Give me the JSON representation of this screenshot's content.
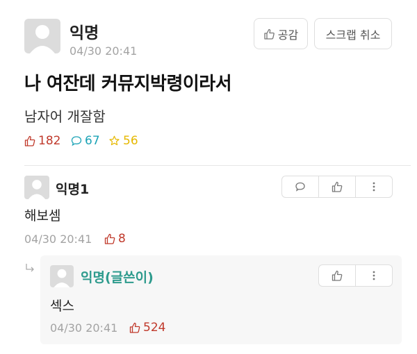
{
  "post": {
    "author": "익명",
    "time": "04/30 20:41",
    "title": "나 여잔데 커뮤지박령이라서",
    "body": "남자어 개잘함",
    "likes": "182",
    "comments": "67",
    "scraps": "56",
    "buttons": {
      "like": "공감",
      "scrap_cancel": "스크랩 취소"
    }
  },
  "comment": {
    "author": "익명1",
    "text": "해보셈",
    "time": "04/30 20:41",
    "likes": "8"
  },
  "reply": {
    "author": "익명(글쓴이)",
    "text": "섹스",
    "time": "04/30 20:41",
    "likes": "524"
  },
  "colors": {
    "like_red": "#c0392b",
    "comment_teal": "#1ca3b6",
    "scrap_yellow": "#e6b800",
    "writer_teal": "#2e9b8d"
  },
  "icons": [
    "avatar-icon",
    "thumbs-up-icon",
    "speech-bubble-icon",
    "star-icon",
    "more-vertical-icon",
    "reply-arrow-icon"
  ]
}
